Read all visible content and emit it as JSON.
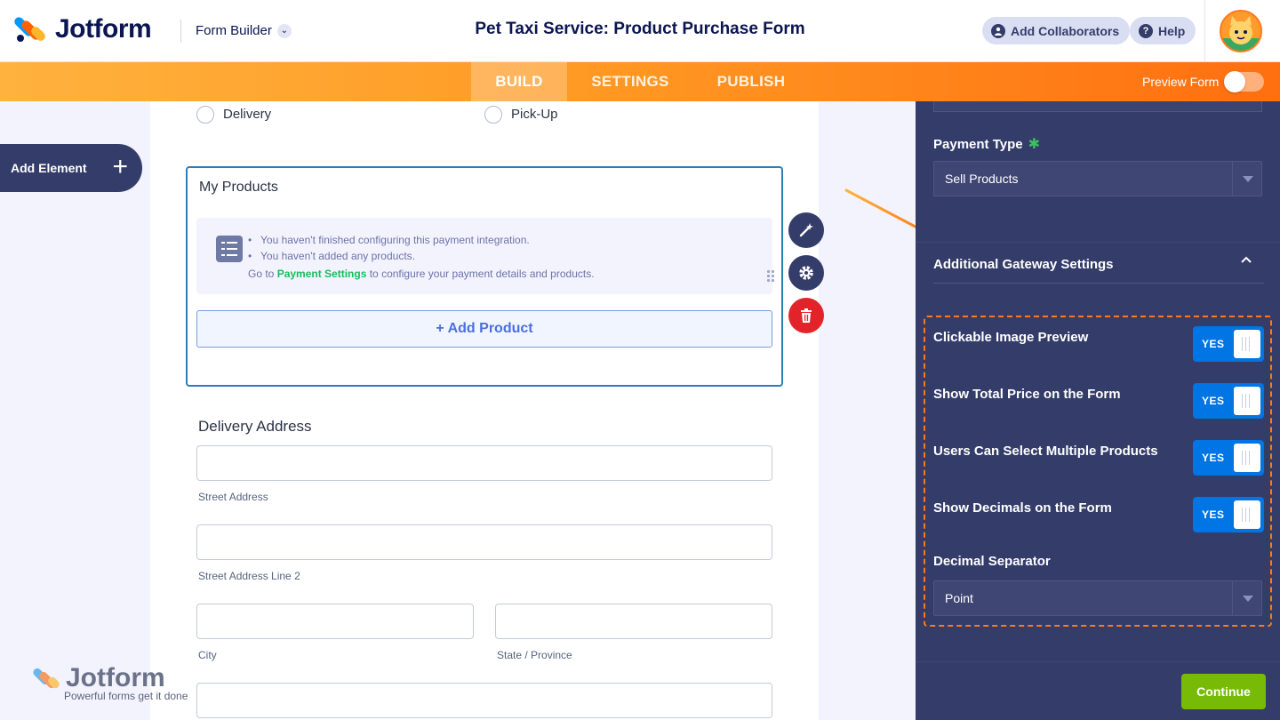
{
  "header": {
    "logo_text": "Jotform",
    "form_builder_label": "Form Builder",
    "form_title": "Pet Taxi Service: Product Purchase Form",
    "add_collaborators_label": "Add Collaborators",
    "help_label": "Help",
    "icons": {
      "collaborators": "user-icon",
      "help": "question-icon",
      "dropdown": "chevron-down-icon"
    }
  },
  "navbar": {
    "tabs": [
      {
        "label": "BUILD",
        "active": true
      },
      {
        "label": "SETTINGS"
      },
      {
        "label": "PUBLISH"
      }
    ],
    "preview_label": "Preview Form",
    "preview_on": false
  },
  "sidebar": {
    "add_element_label": "Add Element",
    "add_icon": "plus-icon"
  },
  "form": {
    "delivery_options": [
      "Delivery",
      "Pick-Up"
    ],
    "products": {
      "title": "My Products",
      "warning_lines": [
        "You haven't finished configuring this payment integration.",
        "You haven't added any products."
      ],
      "goto_prefix": "Go to ",
      "goto_link": "Payment Settings",
      "goto_suffix": " to configure your payment details and products.",
      "add_product_label": "+ Add Product"
    },
    "address": {
      "title": "Delivery Address",
      "street": "Street Address",
      "street2": "Street Address Line 2",
      "city": "City",
      "state": "State / Province"
    }
  },
  "watermark": {
    "title": "Jotform",
    "tagline": "Powerful forms get it done"
  },
  "panel": {
    "payment_type_label": "Payment Type",
    "required_mark": "✱",
    "payment_type_value": "Sell Products",
    "gateway_title": "Additional Gateway Settings",
    "toggles": [
      {
        "label": "Clickable Image Preview",
        "state": "YES"
      },
      {
        "label": "Show Total Price on the Form",
        "state": "YES"
      },
      {
        "label": "Users Can Select Multiple Products",
        "state": "YES"
      },
      {
        "label": "Show Decimals on the Form",
        "state": "YES"
      }
    ],
    "decimal_separator_label": "Decimal Separator",
    "decimal_separator_value": "Point",
    "continue_label": "Continue"
  },
  "colors": {
    "accent_orange": "#ff6f10",
    "panel_bg": "#343c6a",
    "toggle_blue": "#0075e3",
    "continue_green": "#78bb07",
    "link_green": "#18bd5b"
  }
}
